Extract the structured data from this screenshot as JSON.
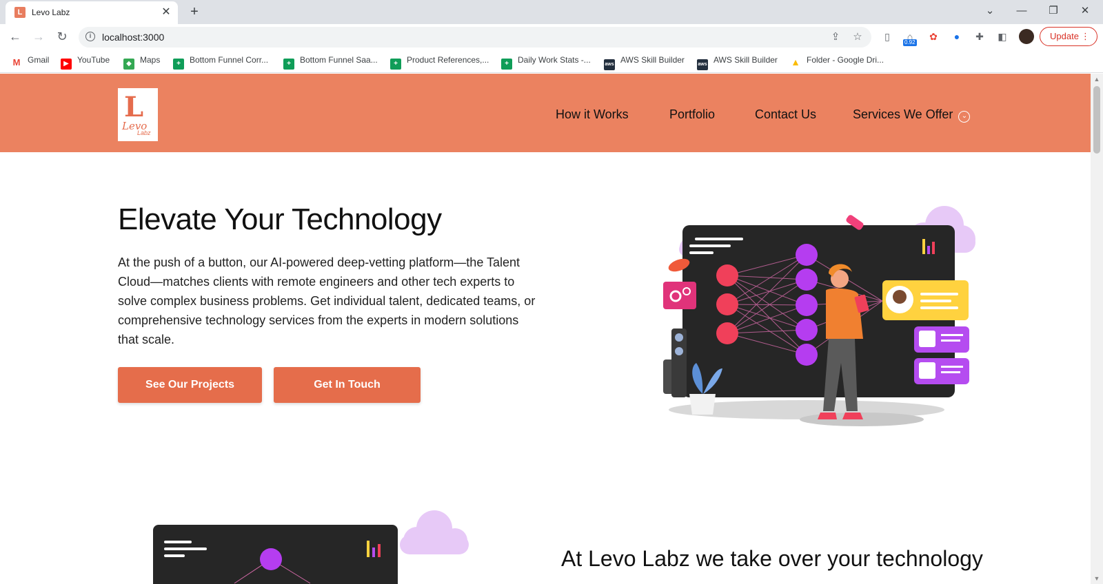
{
  "browser": {
    "tab_title": "Levo Labz",
    "url": "localhost:3000",
    "update_label": "Update",
    "extension_badge": "0.92",
    "bookmarks": [
      {
        "label": "Gmail",
        "icon": "gmail-icon"
      },
      {
        "label": "YouTube",
        "icon": "youtube-icon"
      },
      {
        "label": "Maps",
        "icon": "maps-icon"
      },
      {
        "label": "Bottom Funnel Corr...",
        "icon": "sheets-icon"
      },
      {
        "label": "Bottom Funnel Saa...",
        "icon": "sheets-icon"
      },
      {
        "label": "Product References,...",
        "icon": "sheets-icon"
      },
      {
        "label": "Daily Work Stats -...",
        "icon": "sheets-icon"
      },
      {
        "label": "AWS Skill Builder",
        "icon": "aws-icon"
      },
      {
        "label": "AWS Skill Builder",
        "icon": "aws-icon"
      },
      {
        "label": "Folder - Google Dri...",
        "icon": "drive-icon"
      }
    ]
  },
  "site": {
    "logo": {
      "mark": "L",
      "text": "Levo",
      "sub": "Labz"
    },
    "nav": [
      "How it Works",
      "Portfolio",
      "Contact Us",
      "Services We Offer"
    ],
    "hero": {
      "title": "Elevate Your Technology",
      "body": "At the push of a button, our AI-powered deep-vetting platform—the Talent Cloud—matches clients with remote engineers and other tech experts to solve complex business problems. Get individual talent, dedicated teams, or comprehensive technology services from the experts in modern solutions that scale.",
      "primary_button": "See Our Projects",
      "secondary_button": "Get In Touch"
    },
    "section2_title": "At Levo Labz we take over your technology"
  },
  "colors": {
    "brand": "#eb8260",
    "button": "#e56d4b",
    "node_red": "#f0405a",
    "node_purple": "#b53df0",
    "card_yellow": "#ffd23f",
    "card_purple": "#b54cf0"
  }
}
